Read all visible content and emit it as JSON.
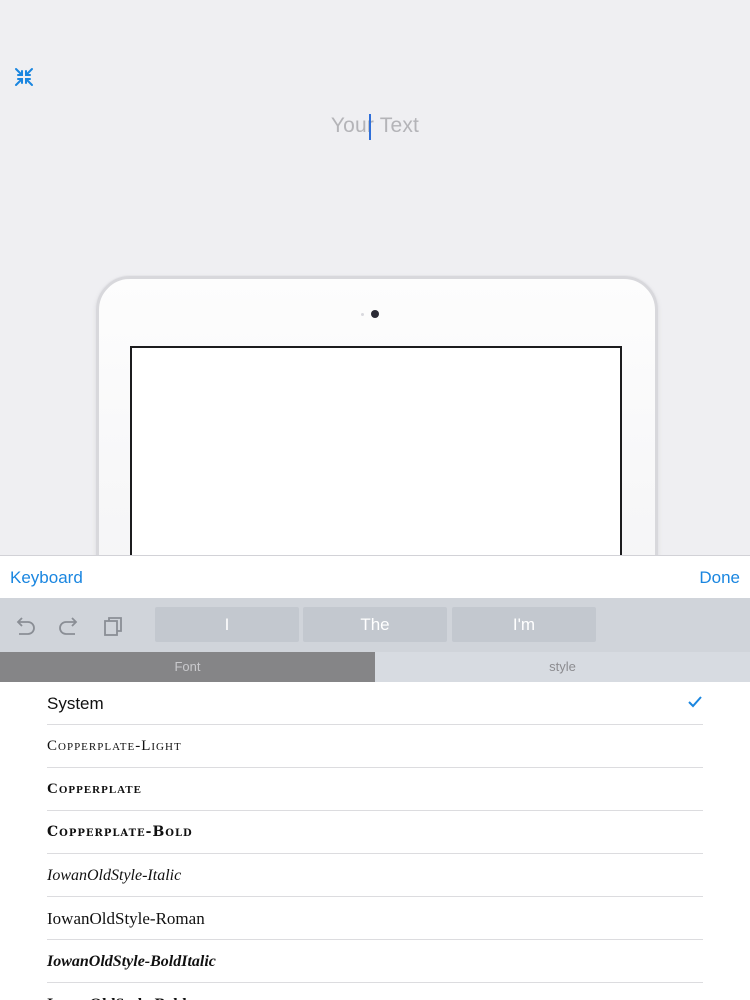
{
  "editor": {
    "text_placeholder": "Your Text",
    "collapse_icon": "collapse-arrows-icon"
  },
  "accessory_bar": {
    "keyboard_label": "Keyboard",
    "done_label": "Done"
  },
  "suggestion_bar": {
    "tools": [
      "undo-icon",
      "redo-icon",
      "clipboard-icon"
    ],
    "suggestions": [
      "I",
      "The",
      "I'm"
    ]
  },
  "tabs": {
    "font_label": "Font",
    "style_label": "style",
    "selected": "Font"
  },
  "font_list": {
    "selected": "System",
    "items": [
      {
        "label": "System"
      },
      {
        "label": "Copperplate-Light"
      },
      {
        "label": "Copperplate"
      },
      {
        "label": "Copperplate-Bold"
      },
      {
        "label": "IowanOldStyle-Italic"
      },
      {
        "label": "IowanOldStyle-Roman"
      },
      {
        "label": "IowanOldStyle-BoldItalic"
      },
      {
        "label": "IowanOldStyle-Bold"
      }
    ]
  },
  "colors": {
    "accent": "#1a86e0",
    "caret": "#2f6fd9",
    "background": "#efeff2"
  }
}
